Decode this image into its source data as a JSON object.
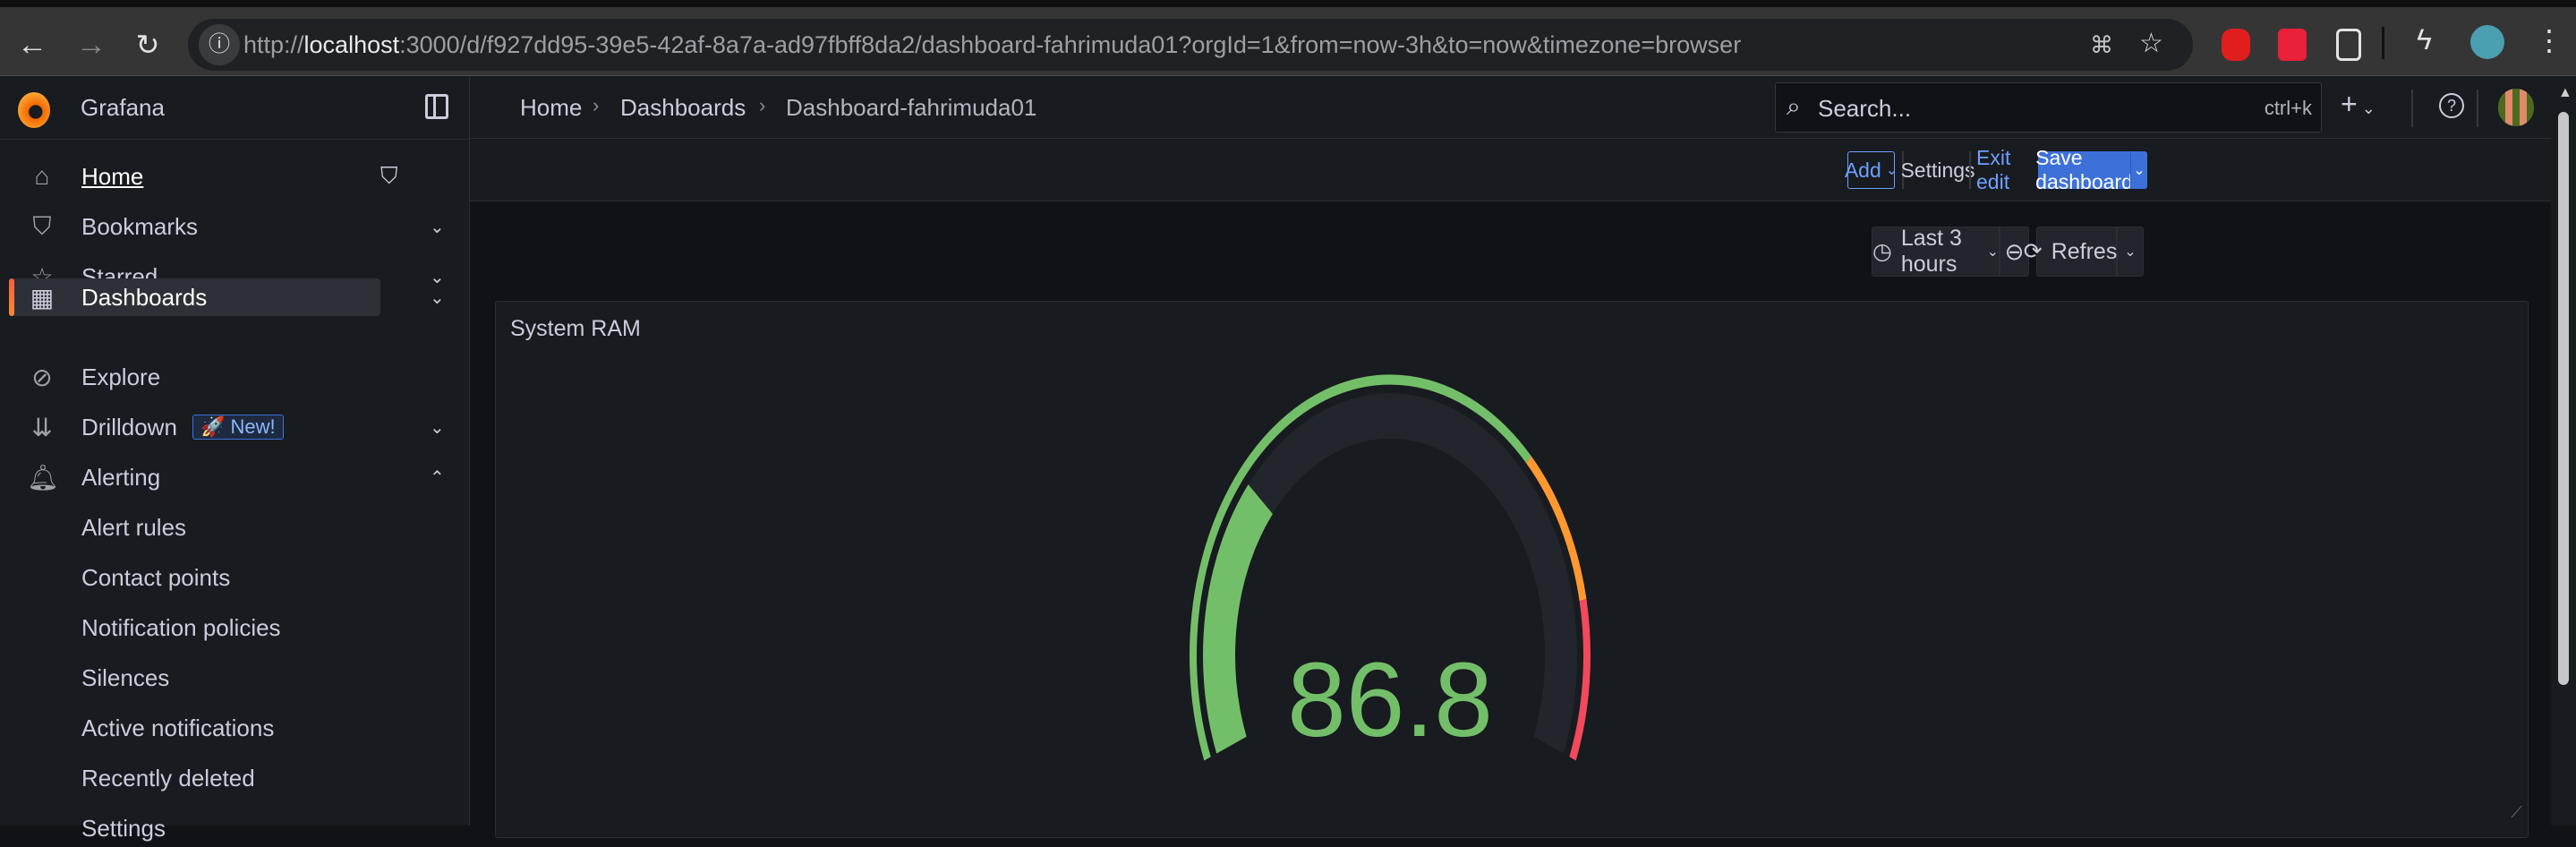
{
  "browser": {
    "url_prefix": "http://",
    "url_host": "localhost",
    "url_rest": ":3000/d/f927dd95-39e5-42af-8a7a-ad97fbff8da2/dashboard-fahrimuda01?orgId=1&from=now-3h&to=now&timezone=browser",
    "icons": [
      "back-icon",
      "forward-icon",
      "reload-icon",
      "info-icon",
      "translate-icon",
      "star-icon",
      "adblock-icon",
      "extension-red-icon",
      "extensions-puzzle-icon",
      "lightning-icon",
      "profile-avatar",
      "menu-kebab-icon"
    ]
  },
  "sidebar": {
    "brand": "Grafana",
    "items": [
      {
        "label": "Home",
        "icon": "home-icon"
      },
      {
        "label": "Bookmarks",
        "icon": "bookmark-icon"
      },
      {
        "label": "Starred",
        "icon": "star-icon"
      },
      {
        "label": "Dashboards",
        "icon": "grid-icon",
        "active": true
      },
      {
        "label": "Explore",
        "icon": "compass-icon"
      },
      {
        "label": "Drilldown",
        "icon": "drilldown-icon",
        "badge": "New!"
      },
      {
        "label": "Alerting",
        "icon": "bell-icon",
        "expanded": true
      }
    ],
    "alerting_children": [
      "Alert rules",
      "Contact points",
      "Notification policies",
      "Silences",
      "Active notifications",
      "Recently deleted",
      "Settings"
    ]
  },
  "breadcrumb": [
    "Home",
    "Dashboards",
    "Dashboard-fahrimuda01"
  ],
  "search": {
    "placeholder": "Search...",
    "shortcut": "ctrl+k"
  },
  "editbar": {
    "add": "Add",
    "settings": "Settings",
    "exit_edit": "Exit edit",
    "save": "Save dashboard"
  },
  "controls": {
    "time_range": "Last 3 hours",
    "refresh": "Refresh"
  },
  "panel": {
    "title": "System RAM",
    "value": "86.8",
    "fill_fraction": 0.28,
    "threshold_fractions": [
      0.7,
      0.85
    ],
    "colors": {
      "value": "#73bf69",
      "track": "#22252b",
      "green": "#73bf69",
      "orange": "#ff9830",
      "red": "#f2495c"
    }
  },
  "accent": {
    "primary": "#3d71d9",
    "active": "#ff7a2a"
  }
}
